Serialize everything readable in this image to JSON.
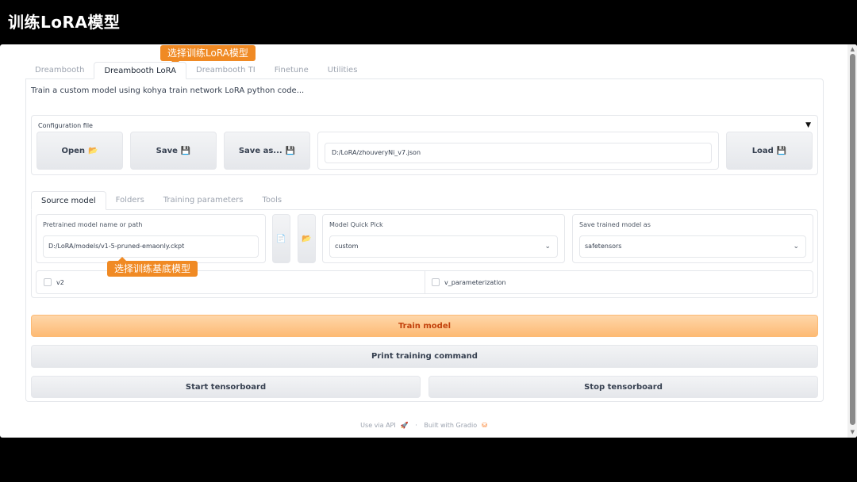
{
  "window": {
    "title": "训练LoRA模型"
  },
  "top_tabs": [
    {
      "label": "Dreambooth",
      "active": false
    },
    {
      "label": "Dreambooth LoRA",
      "active": true
    },
    {
      "label": "Dreambooth TI",
      "active": false
    },
    {
      "label": "Finetune",
      "active": false
    },
    {
      "label": "Utilities",
      "active": false
    }
  ],
  "description": "Train a custom model using kohya train network LoRA python code...",
  "config": {
    "label": "Configuration file",
    "caret": "▼",
    "open_label": "Open",
    "open_icon": "📂",
    "save_label": "Save",
    "save_icon": "💾",
    "save_as_label": "Save as...",
    "save_as_icon": "💾",
    "path": "D:/LoRA/zhouveryNi_v7.json",
    "load_label": "Load",
    "load_icon": "💾"
  },
  "inner_tabs": [
    {
      "label": "Source model",
      "active": true
    },
    {
      "label": "Folders",
      "active": false
    },
    {
      "label": "Training parameters",
      "active": false
    },
    {
      "label": "Tools",
      "active": false
    }
  ],
  "source_model": {
    "pretrained_label": "Pretrained model name or path",
    "pretrained_value": "D:/LoRA/models/v1-5-pruned-emaonly.ckpt",
    "file_icon": "📄",
    "folder_icon": "📂",
    "quick_pick_label": "Model Quick Pick",
    "quick_pick_value": "custom",
    "save_as_label": "Save trained model as",
    "save_as_value": "safetensors",
    "v2_label": "v2",
    "v_param_label": "v_parameterization",
    "chevron": "⌄"
  },
  "actions": {
    "train": "Train model",
    "print": "Print training command",
    "start_tb": "Start tensorboard",
    "stop_tb": "Stop tensorboard"
  },
  "callouts": {
    "tab_callout": "选择训练LoRA模型",
    "model_callout": "选择训练基底模型"
  },
  "footer": {
    "api": "Use via API",
    "rocket": "🚀",
    "dot": "·",
    "built": "Built with Gradio",
    "logo": "⛁"
  },
  "colors": {
    "accent": "#f08a24",
    "train_bg": "#fdba74",
    "train_text": "#c2410c"
  }
}
